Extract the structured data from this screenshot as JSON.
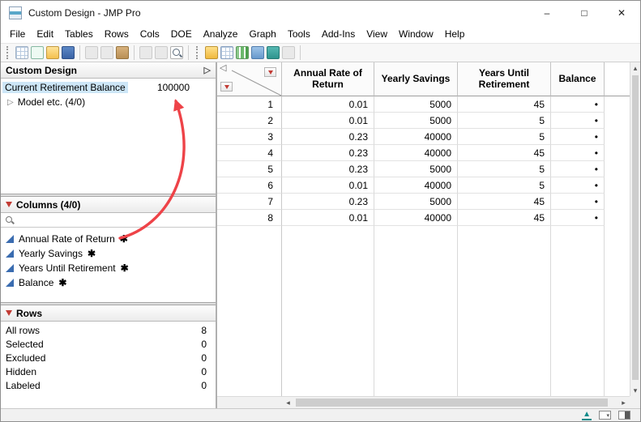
{
  "window": {
    "title": "Custom Design - JMP Pro",
    "controls": {
      "minimize": "–",
      "maximize": "□",
      "close": "✕"
    }
  },
  "menu_items": [
    "File",
    "Edit",
    "Tables",
    "Rows",
    "Cols",
    "DOE",
    "Analyze",
    "Graph",
    "Tools",
    "Add-Ins",
    "View",
    "Window",
    "Help"
  ],
  "toolbar_icon_names": [
    "new-data-table",
    "new-journal",
    "open",
    "save",
    "cut",
    "copy",
    "paste",
    "copy-table",
    "lock",
    "zoom",
    "data-table",
    "new-columns",
    "sort-ascending",
    "filter",
    "run-script",
    "edit-pencil"
  ],
  "design_panel": {
    "title": "Custom Design",
    "selected_row": {
      "label": "Current Retirement Balance",
      "value": "100000"
    },
    "model_row": {
      "label": "Model etc. (4/0)"
    }
  },
  "columns_panel": {
    "title": "Columns (4/0)",
    "search_value": "",
    "items": [
      {
        "label": "Annual Rate of Return",
        "marker": "✱"
      },
      {
        "label": "Yearly Savings",
        "marker": "✱"
      },
      {
        "label": "Years Until Retirement",
        "marker": "✱"
      },
      {
        "label": "Balance",
        "marker": "✱"
      }
    ]
  },
  "rows_panel": {
    "title": "Rows",
    "stats": [
      {
        "label": "All rows",
        "value": "8"
      },
      {
        "label": "Selected",
        "value": "0"
      },
      {
        "label": "Excluded",
        "value": "0"
      },
      {
        "label": "Hidden",
        "value": "0"
      },
      {
        "label": "Labeled",
        "value": "0"
      }
    ]
  },
  "table": {
    "headers": [
      "Annual Rate of Return",
      "Yearly Savings",
      "Years Until Retirement",
      "Balance"
    ],
    "rows": [
      {
        "num": "1",
        "c1": "0.01",
        "c2": "5000",
        "c3": "45",
        "c4": "•"
      },
      {
        "num": "2",
        "c1": "0.01",
        "c2": "5000",
        "c3": "5",
        "c4": "•"
      },
      {
        "num": "3",
        "c1": "0.23",
        "c2": "40000",
        "c3": "5",
        "c4": "•"
      },
      {
        "num": "4",
        "c1": "0.23",
        "c2": "40000",
        "c3": "45",
        "c4": "•"
      },
      {
        "num": "5",
        "c1": "0.23",
        "c2": "5000",
        "c3": "5",
        "c4": "•"
      },
      {
        "num": "6",
        "c1": "0.01",
        "c2": "40000",
        "c3": "5",
        "c4": "•"
      },
      {
        "num": "7",
        "c1": "0.23",
        "c2": "5000",
        "c3": "45",
        "c4": "•"
      },
      {
        "num": "8",
        "c1": "0.01",
        "c2": "40000",
        "c3": "45",
        "c4": "•"
      }
    ]
  },
  "icons": {
    "disclosure": "▷",
    "collapse_left": "◁",
    "hscroll_left": "◂",
    "hscroll_right": "▸",
    "vscroll_up": "▴",
    "vscroll_down": "▾",
    "status_up": "▲",
    "panel_dropdown": "▾"
  },
  "colors": {
    "selection_blue": "#cde6f7",
    "red_triangle": "#c23b34",
    "column_icon_blue": "#3a6cb0",
    "annotation_red": "#ee4348"
  }
}
